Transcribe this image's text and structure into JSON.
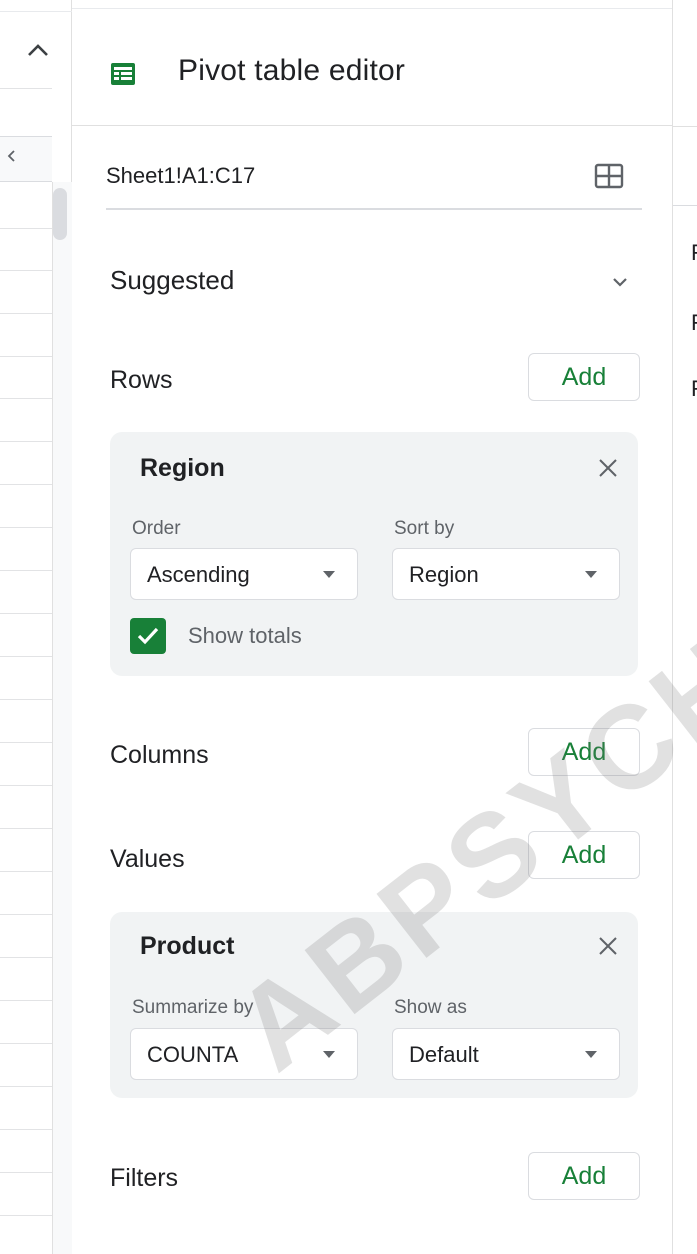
{
  "editor": {
    "title": "Pivot table editor",
    "title_icon": "pivot-table-icon",
    "data_range": "Sheet1!A1:C17",
    "range_icon": "select-range-grid-icon"
  },
  "sections": {
    "suggested": "Suggested",
    "rows": "Rows",
    "columns": "Columns",
    "values": "Values",
    "filters": "Filters",
    "add_label": "Add"
  },
  "rows_card": {
    "field": "Region",
    "order_label": "Order",
    "order_value": "Ascending",
    "sortby_label": "Sort by",
    "sortby_value": "Region",
    "show_totals_label": "Show totals",
    "show_totals_checked": true
  },
  "values_card": {
    "field": "Product",
    "summarize_label": "Summarize by",
    "summarize_value": "COUNTA",
    "showas_label": "Show as",
    "showas_value": "Default"
  },
  "right_panel": {
    "row_texts": [
      "F",
      "F",
      "F"
    ]
  },
  "watermark": "ABPSYCHO",
  "colors": {
    "accent_green": "#188038",
    "card_bg": "#f1f3f4",
    "border": "#dadce0"
  }
}
